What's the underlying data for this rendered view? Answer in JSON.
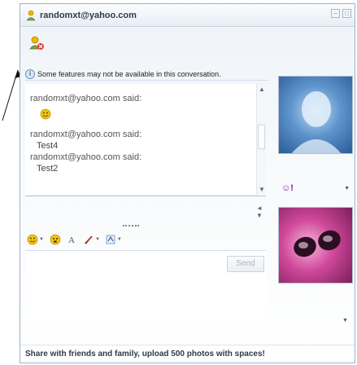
{
  "window": {
    "title": "randomxt@yahoo.com",
    "controls": [
      "minimize",
      "maximize"
    ]
  },
  "info_bar": {
    "text": "Some features may not be available in this conversation."
  },
  "conversation": [
    {
      "sender": "randomxt@yahoo.com said:",
      "message": "",
      "emoticon": "smiley-icon"
    },
    {
      "sender": "randomxt@yahoo.com said:",
      "message": "Test4"
    },
    {
      "sender": "randomxt@yahoo.com said:",
      "message": "Test2"
    }
  ],
  "toolbar": {
    "icons": [
      "emoticon-icon",
      "audible-icon",
      "font-icon",
      "color-icon",
      "format-icon"
    ]
  },
  "input": {
    "send_label": "Send"
  },
  "footer": {
    "promo_text": "Share with friends and family, upload 500 photos with spaces!"
  },
  "colors": {
    "title_text": "#2f3b4a",
    "ym_purple": "#7b1fa2"
  }
}
